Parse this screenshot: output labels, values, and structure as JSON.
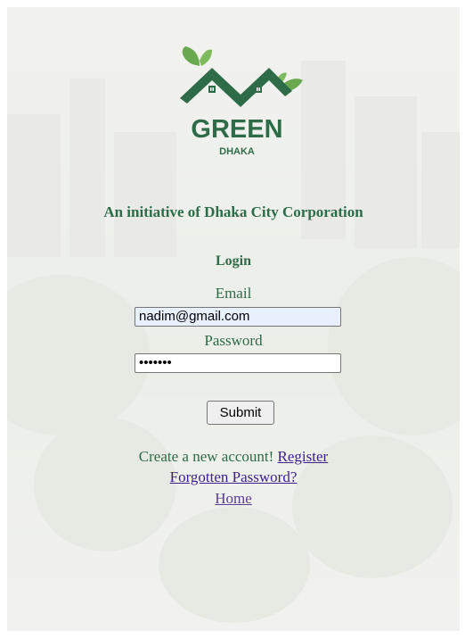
{
  "brand": {
    "logo_word": "GREEN",
    "logo_subword": "DHAKA",
    "colors": {
      "primary": "#2e6b48",
      "leaf": "#6aa84f",
      "link": "#3c1f8a",
      "visited_link": "#5a3e8e"
    }
  },
  "tagline": "An initiative of Dhaka City Corporation",
  "login": {
    "title": "Login",
    "email_label": "Email",
    "email_value": "nadim@gmail.com",
    "password_label": "Password",
    "password_value": "•••••••",
    "submit_label": "Submit"
  },
  "footer": {
    "create_text": "Create a new account!",
    "register_link": "Register",
    "forgot_link": "Forgotten Password?",
    "home_link": "Home"
  }
}
